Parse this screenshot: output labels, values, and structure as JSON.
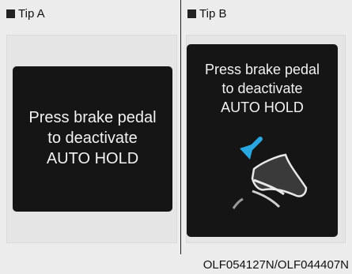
{
  "tips": [
    {
      "header": "Tip A",
      "message": "Press brake pedal\nto deactivate\nAUTO HOLD",
      "icon": "square-bullet-icon"
    },
    {
      "header": "Tip B",
      "message": "Press brake pedal\nto deactivate\nAUTO HOLD",
      "icon": "square-bullet-icon",
      "illustration": "brake-pedal-icon"
    }
  ],
  "caption": "OLF054127N/OLF044407N",
  "colors": {
    "screen": "#151515",
    "screen_text": "#f2f2f2",
    "arrow": "#2aa6e0",
    "background": "#ececec"
  }
}
